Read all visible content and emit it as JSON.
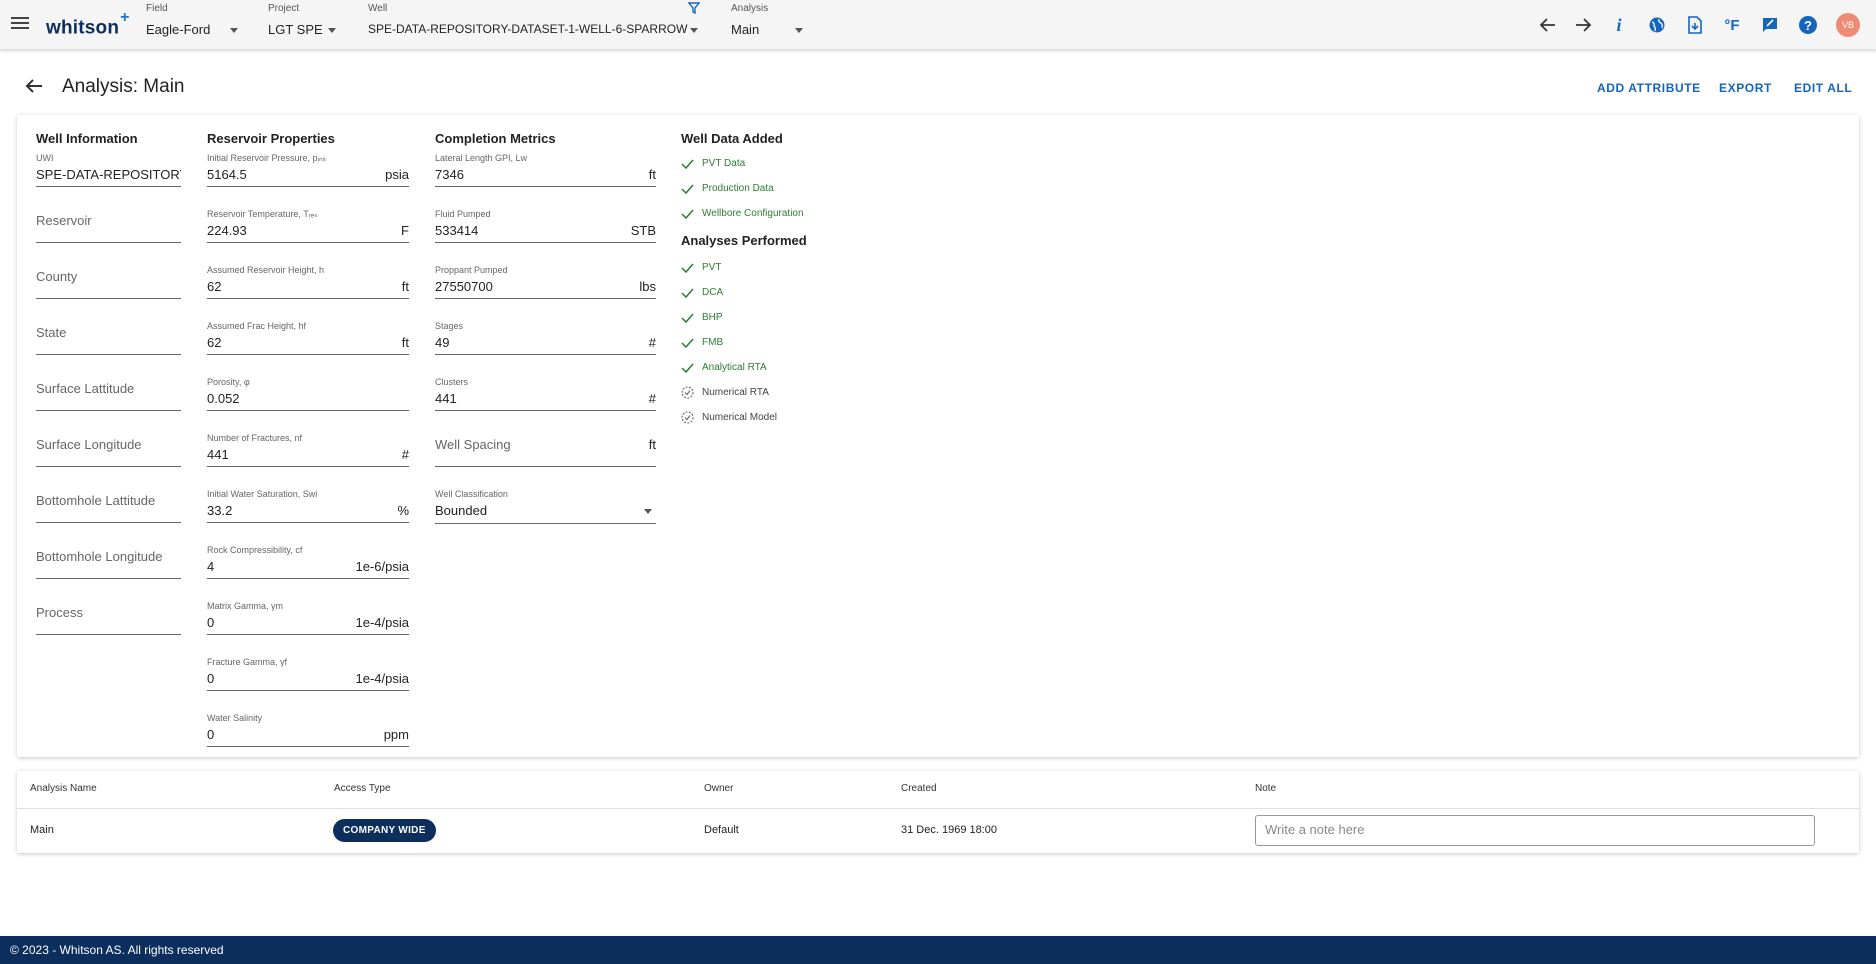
{
  "app": {
    "logo": "whitson",
    "logo_plus": "+"
  },
  "topbar": {
    "field": {
      "label": "Field",
      "value": "Eagle-Ford"
    },
    "project": {
      "label": "Project",
      "value": "LGT SPE"
    },
    "well": {
      "label": "Well",
      "value": "SPE-DATA-REPOSITORY-DATASET-1-WELL-6-SPARROW"
    },
    "analysis": {
      "label": "Analysis",
      "value": "Main"
    },
    "temp_unit": "°F",
    "info_glyph": "i",
    "help_glyph": "?",
    "avatar_initials": "VB",
    "icons": [
      "menu-icon",
      "filter-icon",
      "arrow-back-icon",
      "arrow-forward-icon",
      "info-icon",
      "globe-icon",
      "file-download-icon",
      "temperature-unit-icon",
      "feedback-icon",
      "help-icon"
    ]
  },
  "header": {
    "title": "Analysis: Main",
    "actions": {
      "add_attribute": "ADD ATTRIBUTE",
      "export": "EXPORT",
      "edit_all": "EDIT ALL"
    }
  },
  "well_information": {
    "title": "Well Information",
    "uwi": {
      "label": "UWI",
      "value": "SPE-DATA-REPOSITORY-DATASET-1-WELL-6-SPARROW"
    },
    "placeholders": [
      "Reservoir",
      "County",
      "State",
      "Surface Lattitude",
      "Surface Longitude",
      "Bottomhole Lattitude",
      "Bottomhole Longitude",
      "Process"
    ]
  },
  "reservoir_properties": {
    "title": "Reservoir Properties",
    "fields": [
      {
        "label": "Initial Reservoir Pressure, pᵢₙᵢₜ",
        "value": "5164.5",
        "unit": "psia"
      },
      {
        "label": "Reservoir Temperature, Tᵣₑₛ",
        "value": "224.93",
        "unit": "F"
      },
      {
        "label": "Assumed Reservoir Height, h",
        "value": "62",
        "unit": "ft"
      },
      {
        "label": "Assumed Frac Height, hf",
        "value": "62",
        "unit": "ft"
      },
      {
        "label": "Porosity, φ",
        "value": "0.052",
        "unit": ""
      },
      {
        "label": "Number of Fractures, nf",
        "value": "441",
        "unit": "#"
      },
      {
        "label": "Initial Water Saturation, Swi",
        "value": "33.2",
        "unit": "%"
      },
      {
        "label": "Rock Compressibility, cf",
        "value": "4",
        "unit": "1e-6/psia"
      },
      {
        "label": "Matrix Gamma, γm",
        "value": "0",
        "unit": "1e-4/psia"
      },
      {
        "label": "Fracture Gamma, γf",
        "value": "0",
        "unit": "1e-4/psia"
      },
      {
        "label": "Water Salinity",
        "value": "0",
        "unit": "ppm"
      }
    ]
  },
  "completion_metrics": {
    "title": "Completion Metrics",
    "fields": [
      {
        "label": "Lateral Length GPI, Lw",
        "value": "7346",
        "unit": "ft"
      },
      {
        "label": "Fluid Pumped",
        "value": "533414",
        "unit": "STB"
      },
      {
        "label": "Proppant Pumped",
        "value": "27550700",
        "unit": "lbs"
      },
      {
        "label": "Stages",
        "value": "49",
        "unit": "#"
      },
      {
        "label": "Clusters",
        "value": "441",
        "unit": "#"
      }
    ],
    "well_spacing": {
      "placeholder": "Well Spacing",
      "unit": "ft"
    },
    "well_classification": {
      "label": "Well Classification",
      "value": "Bounded"
    }
  },
  "well_data_added": {
    "title": "Well Data Added",
    "items": [
      "PVT Data",
      "Production Data",
      "Wellbore Configuration"
    ]
  },
  "analyses_performed": {
    "title": "Analyses Performed",
    "done": [
      "PVT",
      "DCA",
      "BHP",
      "FMB",
      "Analytical RTA"
    ],
    "pending": [
      "Numerical RTA",
      "Numerical Model"
    ]
  },
  "table": {
    "headers": {
      "name": "Analysis Name",
      "access": "Access Type",
      "owner": "Owner",
      "created": "Created",
      "note": "Note"
    },
    "row": {
      "name": "Main",
      "access": "COMPANY WIDE",
      "owner": "Default",
      "created": "31 Dec. 1969 18:00",
      "note_placeholder": "Write a note here"
    }
  },
  "footer": {
    "text": "© 2023 - Whitson AS. All rights reserved"
  },
  "colors": {
    "primary": "#1565c0",
    "navy": "#0b2e5c",
    "success": "#2e7d32",
    "avatar": "#ef8a75"
  }
}
